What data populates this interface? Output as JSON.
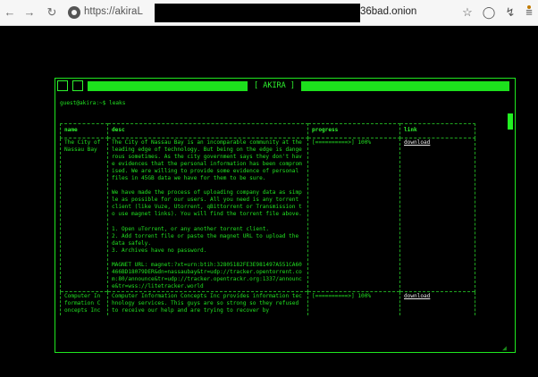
{
  "browser": {
    "url_prefix": "https://akiraL",
    "url_suffix": "36bad.onion",
    "back_icon": "arrow-left",
    "forward_icon": "arrow-right",
    "reload_icon": "reload",
    "star_icon": "star",
    "shield_icon": "shield",
    "extensions_icon": "puzzle",
    "menu_icon": "hamburger"
  },
  "terminal": {
    "title": "[ AKIRA ]",
    "prompt": "guest@akira:~$ leaks",
    "accent_color": "#22e822",
    "table": {
      "headers": [
        "name",
        "desc",
        "progress",
        "link"
      ],
      "rows": [
        {
          "name": "The City of Nassau Bay",
          "desc": "The City of Nassau Bay is an incomparable community at the leading edge of technology. But being on the edge is dangerous sometimes. As the city government says they don't have evidences that the personal information has been compromised. We are willing to provide some evidence of personal files in 45GB data we have for them to be sure.\n\nWe have made the process of uploading company data as simple as possible for our users. All you need is any torrent client (like Vuze, Utorrent, qBittorrent or Transmission to use magnet links). You will find the torrent file above.\n\n1. Open uTorrent, or any another torrent client.\n2. Add torrent file or paste the magnet URL to upload the data safely.\n3. Archives have no password.\n\nMAGNET URL: magnet:?xt=urn:btih:32805182FE3E981497A551CA60466BD18079DER&dn=nassaubay&tr=udp://tracker.opentorrent.com:80/announce&tr=udp://tracker.opentrackr.org:1337/announce&tr=wss://litetracker.world",
          "progress": "[==========>] 100%",
          "link": "download"
        },
        {
          "name": "Computer Information Concepts Inc",
          "desc": "Computer Information Concepts Inc provides information technology services. This guys are so strong so they refused to receive our help and are trying to recover by",
          "progress": "[==========>] 100%",
          "link": "download"
        }
      ]
    }
  }
}
